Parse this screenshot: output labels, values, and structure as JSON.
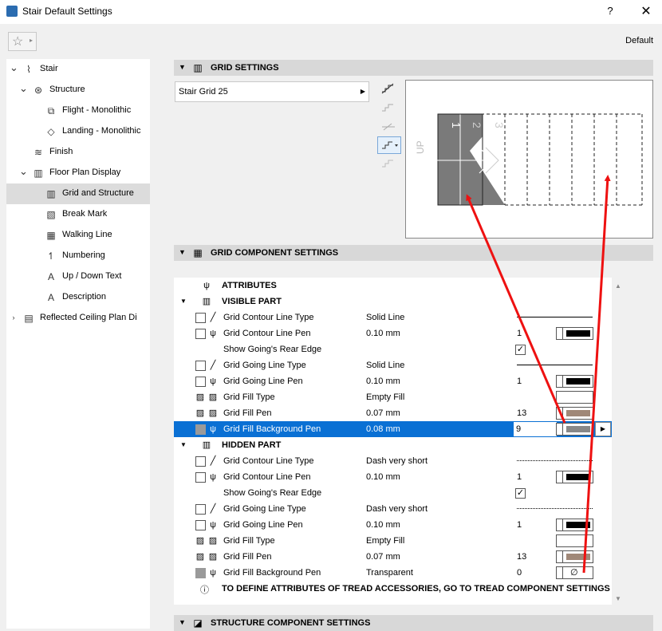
{
  "window": {
    "title": "Stair Default Settings",
    "help": "?",
    "close": "✕"
  },
  "favorites": {
    "star": "☆",
    "arrow": "▸"
  },
  "default_label": "Default",
  "tree": [
    {
      "label": "Stair",
      "icon": "stair-icon",
      "level": 0,
      "expander": "open"
    },
    {
      "label": "Structure",
      "icon": "structure-icon",
      "level": 1,
      "expander": "open"
    },
    {
      "label": "Flight - Monolithic",
      "icon": "flight-icon",
      "level": 2,
      "expander": ""
    },
    {
      "label": "Landing - Monolithic",
      "icon": "landing-icon",
      "level": 2,
      "expander": ""
    },
    {
      "label": "Finish",
      "icon": "finish-icon",
      "level": 1,
      "expander": ""
    },
    {
      "label": "Floor Plan Display",
      "icon": "floor-plan-icon",
      "level": 1,
      "expander": "open"
    },
    {
      "label": "Grid and Structure",
      "icon": "grid-icon",
      "level": 2,
      "expander": "",
      "selected": true
    },
    {
      "label": "Break Mark",
      "icon": "break-mark-icon",
      "level": 2,
      "expander": ""
    },
    {
      "label": "Walking Line",
      "icon": "walking-line-icon",
      "level": 2,
      "expander": ""
    },
    {
      "label": "Numbering",
      "icon": "numbering-icon",
      "level": 2,
      "expander": ""
    },
    {
      "label": "Up / Down Text",
      "icon": "text-icon",
      "level": 2,
      "expander": ""
    },
    {
      "label": "Description",
      "icon": "text-icon",
      "level": 2,
      "expander": ""
    },
    {
      "label": "Reflected Ceiling Plan Di",
      "icon": "ceiling-plan-icon",
      "level": 0,
      "expander": "closed"
    }
  ],
  "grid_settings": {
    "title": "GRID SETTINGS",
    "selected_grid": "Stair Grid 25",
    "preview": {
      "numbers": [
        "1",
        "2",
        "3"
      ],
      "up_text": "UP"
    }
  },
  "grid_component": {
    "title": "GRID COMPONENT SETTINGS",
    "attributes_label": "ATTRIBUTES",
    "visible_part_label": "VISIBLE PART",
    "hidden_part_label": "HIDDEN PART",
    "footer_note": "TO DEFINE ATTRIBUTES OF TREAD ACCESSORIES, GO TO TREAD COMPONENT SETTINGS",
    "footer_icon": "ⓘ",
    "visible": [
      {
        "label": "Grid Contour Line Type",
        "value": "Solid Line",
        "num": "",
        "kind": "line-solid",
        "icon": "line-type-icon"
      },
      {
        "label": "Grid Contour Line Pen",
        "value": "0.10 mm",
        "num": "1",
        "kind": "pen",
        "color": "#000000",
        "icon": "pen-icon"
      },
      {
        "label": "Show Going's Rear Edge",
        "value": "",
        "num": "",
        "kind": "check",
        "checked": true,
        "icon": ""
      },
      {
        "label": "Grid Going Line Type",
        "value": "Solid Line",
        "num": "",
        "kind": "line-solid",
        "icon": "line-type-icon"
      },
      {
        "label": "Grid Going Line Pen",
        "value": "0.10 mm",
        "num": "1",
        "kind": "pen",
        "color": "#000000",
        "icon": "pen-icon"
      },
      {
        "label": "Grid Fill Type",
        "value": "Empty Fill",
        "num": "",
        "kind": "fill-empty",
        "icon": "fill-type-icon"
      },
      {
        "label": "Grid Fill Pen",
        "value": "0.07 mm",
        "num": "13",
        "kind": "pen",
        "color": "#a08878",
        "icon": "fill-pen-icon"
      },
      {
        "label": "Grid Fill Background Pen",
        "value": "0.08 mm",
        "num": "9",
        "kind": "pen-edit",
        "color": "#888888",
        "icon": "background-pen-icon",
        "selected": true
      }
    ],
    "hidden": [
      {
        "label": "Grid Contour Line Type",
        "value": "Dash very short",
        "num": "",
        "kind": "line-dash",
        "icon": "line-type-icon"
      },
      {
        "label": "Grid Contour Line Pen",
        "value": "0.10 mm",
        "num": "1",
        "kind": "pen",
        "color": "#000000",
        "icon": "pen-icon"
      },
      {
        "label": "Show Going's Rear Edge",
        "value": "",
        "num": "",
        "kind": "check",
        "checked": true,
        "icon": ""
      },
      {
        "label": "Grid Going Line Type",
        "value": "Dash very short",
        "num": "",
        "kind": "line-dash",
        "icon": "line-type-icon"
      },
      {
        "label": "Grid Going Line Pen",
        "value": "0.10 mm",
        "num": "1",
        "kind": "pen",
        "color": "#000000",
        "icon": "pen-icon"
      },
      {
        "label": "Grid Fill Type",
        "value": "Empty Fill",
        "num": "",
        "kind": "fill-empty",
        "icon": "fill-type-icon"
      },
      {
        "label": "Grid Fill Pen",
        "value": "0.07 mm",
        "num": "13",
        "kind": "pen",
        "color": "#a08878",
        "icon": "fill-pen-icon"
      },
      {
        "label": "Grid Fill Background Pen",
        "value": "Transparent",
        "num": "0",
        "kind": "pen-transparent",
        "icon": "background-pen-icon"
      }
    ]
  },
  "structure_component": {
    "title": "STRUCTURE COMPONENT SETTINGS"
  },
  "annotation_color": "#ee1111",
  "selection_color": "#0a70d4"
}
